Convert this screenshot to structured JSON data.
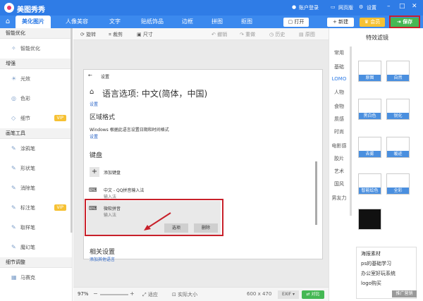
{
  "app": {
    "title": "美图秀秀",
    "account": "账户登录",
    "web_version": "网页版",
    "settings": "设置",
    "win_min": "–",
    "win_max": "□",
    "win_close": "✕"
  },
  "tabs": [
    "美化图片",
    "人像美容",
    "文字",
    "贴纸饰品",
    "边框",
    "拼图",
    "抠图"
  ],
  "top_buttons": {
    "open": "打开",
    "new": "新建",
    "vip": "会员",
    "save": "保存"
  },
  "sidebar": {
    "sections": [
      {
        "title": "智能优化",
        "items": [
          {
            "label": "智能优化",
            "vip": false,
            "icon": "✧"
          }
        ]
      },
      {
        "title": "增强",
        "items": [
          {
            "label": "光效",
            "vip": false,
            "icon": "☀"
          },
          {
            "label": "色彩",
            "vip": false,
            "icon": "◎"
          },
          {
            "label": "细节",
            "vip": true,
            "icon": "◇"
          }
        ]
      },
      {
        "title": "画笔工具",
        "items": [
          {
            "label": "涂鸦笔",
            "vip": false,
            "icon": "✎"
          },
          {
            "label": "形状笔",
            "vip": false,
            "icon": "✎"
          },
          {
            "label": "消除笔",
            "vip": false,
            "icon": "✎"
          },
          {
            "label": "标注笔",
            "vip": true,
            "icon": "✎"
          },
          {
            "label": "取样笔",
            "vip": false,
            "icon": "✎"
          },
          {
            "label": "魔幻笔",
            "vip": false,
            "icon": "✎"
          }
        ]
      },
      {
        "title": "细节调整",
        "items": [
          {
            "label": "马赛克",
            "vip": false,
            "icon": "▦"
          }
        ]
      }
    ],
    "vip_label": "VIP"
  },
  "toolbar": {
    "rotate": "旋转",
    "crop": "裁剪",
    "size": "尺寸",
    "undo": "撤销",
    "redo": "重做",
    "history": "历史",
    "original": "原图"
  },
  "screenshot": {
    "window_title": "设置",
    "heading": "语言选项: 中文(简体，中国)",
    "settings_link": "设置",
    "regional_title": "区域格式",
    "regional_desc": "Windows 根据此语言设置日期和时间格式",
    "regional_link": "设置",
    "keyboard_title": "键盘",
    "add_keyboard": "添加键盘",
    "ime1_name": "中文 - QQ拼音输入法",
    "ime1_type": "输入法",
    "ime2_name": "微软拼音",
    "ime2_type": "输入法",
    "options_btn": "选项",
    "delete_btn": "删除",
    "related_title": "相关设置",
    "related_link": "添加其他语言"
  },
  "bottombar": {
    "zoom": "97%",
    "fit": "适应",
    "actual": "实际大小",
    "dims": "600 x 470",
    "exif": "EXIF",
    "compare": "对比"
  },
  "effects": {
    "title": "特效滤镜",
    "categories": [
      "常用",
      "基础",
      "LOMO",
      "人物",
      "食物",
      "质感",
      "时尚",
      "电影感",
      "胶片",
      "艺术",
      "国风",
      "男友力"
    ],
    "thumbs": [
      "原图",
      "自然",
      "黑白色",
      "锐化",
      "去雾",
      "暖迹",
      "智能绘色",
      "全彩",
      ""
    ]
  },
  "tips": [
    "海报素材",
    "ps的基础学习",
    "办公室好玩系统",
    "logo购买"
  ],
  "tips_footer": "推广营销",
  "colors": {
    "brand_blue": "#2f7ce6",
    "save_green": "#45b854",
    "vip_gold": "#f6c133",
    "highlight_red": "#c8202a"
  }
}
